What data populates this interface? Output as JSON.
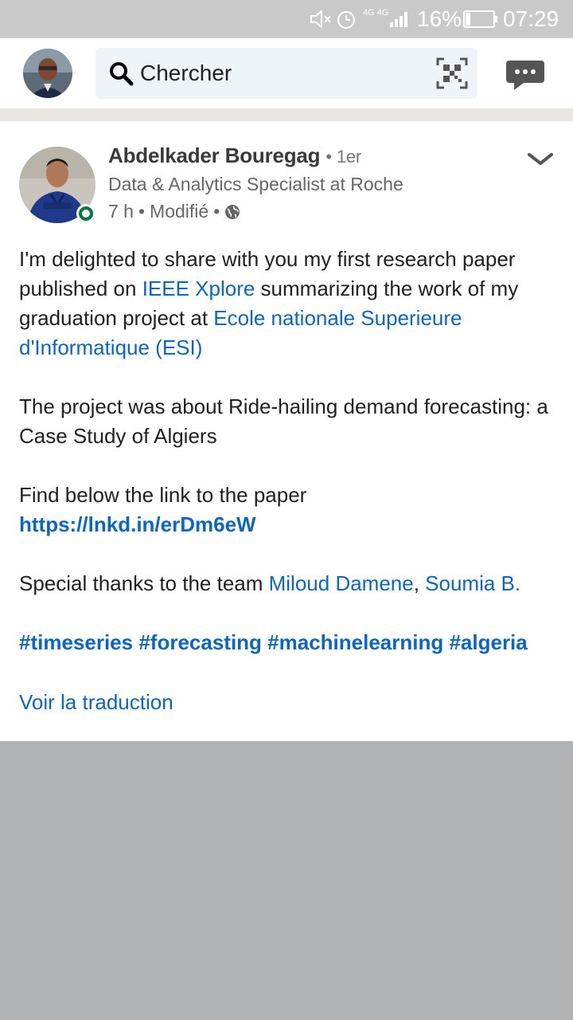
{
  "status_bar": {
    "network": "4G 4G",
    "battery_percent": "16%",
    "time": "07:29",
    "icons": [
      "mute-icon",
      "alarm-icon",
      "signal-icon",
      "battery-icon"
    ]
  },
  "header": {
    "search_placeholder": "Chercher",
    "icons": [
      "search-icon",
      "qr-code-icon",
      "messages-icon"
    ]
  },
  "post": {
    "author": {
      "name": "Abdelkader Bouregag",
      "degree": "1er",
      "headline": "Data & Analytics Specialist at Roche",
      "time": "7 h",
      "edited": "Modifié",
      "visibility_icon": "globe-icon",
      "online": true
    },
    "body": {
      "p1_pre": "I'm delighted to share with you my first research paper published on ",
      "p1_link1": "IEEE Xplore",
      "p1_mid": " summarizing the work of my graduation project at ",
      "p1_link2": "Ecole nationale Superieure d'Informatique (ESI)",
      "p2": "The project was about Ride-hailing demand forecasting: a Case Study of Algiers",
      "p3_text": "Find below the link to the paper",
      "p3_url": "https://lnkd.in/erDm6eW",
      "p4_pre": "Special thanks to the team ",
      "p4_mention1": "Miloud Damene",
      "p4_sep": ", ",
      "p4_mention2": "Soumia B.",
      "hashtags": "#timeseries #forecasting #machinelearning #algeria"
    },
    "translate_label": "Voir la traduction"
  },
  "colors": {
    "link": "#0a66c2",
    "status_bar": "#c9c9c9",
    "search_bg": "#eef3f8",
    "backdrop": "#b1b4b7",
    "online": "#057642"
  }
}
